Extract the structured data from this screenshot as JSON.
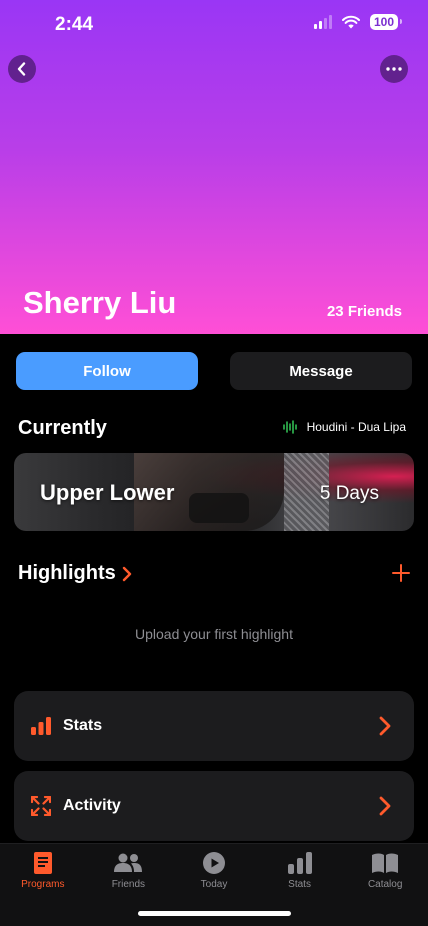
{
  "status": {
    "time": "2:44",
    "battery": "100"
  },
  "profile": {
    "name": "Sherry Liu",
    "friends": "23 Friends"
  },
  "actions": {
    "follow": "Follow",
    "message": "Message"
  },
  "currently": {
    "title": "Currently",
    "now_playing": "Houdini - Dua Lipa",
    "program": {
      "name": "Upper Lower",
      "days": "5 Days"
    }
  },
  "highlights": {
    "title": "Highlights",
    "empty": "Upload your first highlight"
  },
  "rows": {
    "stats": "Stats",
    "activity": "Activity"
  },
  "tabs": [
    {
      "label": "Programs",
      "icon": "book-icon"
    },
    {
      "label": "Friends",
      "icon": "people-icon"
    },
    {
      "label": "Today",
      "icon": "play-icon"
    },
    {
      "label": "Stats",
      "icon": "bar-chart-icon"
    },
    {
      "label": "Catalog",
      "icon": "open-book-icon"
    }
  ],
  "colors": {
    "accent": "#ff5a2c",
    "follow": "#4a9cff",
    "audio": "#34c759",
    "hero_top": "#9a36f5",
    "hero_bottom": "#ff4fd6"
  }
}
